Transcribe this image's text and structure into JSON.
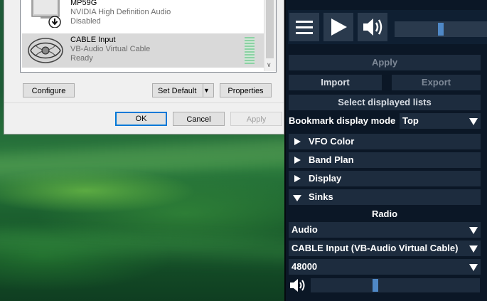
{
  "sound_dialog": {
    "devices": [
      {
        "name": "MP59G",
        "description": "NVIDIA High Definition Audio",
        "state": "Disabled"
      },
      {
        "name": "CABLE Input",
        "description": "VB-Audio Virtual Cable",
        "state": "Ready"
      }
    ],
    "buttons": {
      "configure": "Configure",
      "set_default": "Set Default",
      "properties": "Properties",
      "ok": "OK",
      "cancel": "Cancel",
      "apply": "Apply"
    }
  },
  "sdr_panel": {
    "toolbar": {
      "menu_icon": "hamburger-icon",
      "play_icon": "play-icon",
      "volume_icon": "speaker-icon",
      "volume_level": 0.5
    },
    "apply": "Apply",
    "import": "Import",
    "export": "Export",
    "select_displayed_lists": "Select displayed lists",
    "bookmark_display_mode_label": "Bookmark display mode",
    "bookmark_display_mode_value": "Top",
    "sections": [
      {
        "label": "VFO Color",
        "expanded": false
      },
      {
        "label": "Band Plan",
        "expanded": false
      },
      {
        "label": "Display",
        "expanded": false
      },
      {
        "label": "Sinks",
        "expanded": true
      }
    ],
    "sinks": {
      "title": "Radio",
      "sink_type": "Audio",
      "device": "CABLE Input (VB-Audio Virtual Cable)",
      "sample_rate": "48000",
      "volume_level": 0.38
    },
    "colors": {
      "panel_bg": "#0b1726",
      "control_bg": "#1d2c3e",
      "slider_accent": "#4f88c6"
    }
  }
}
